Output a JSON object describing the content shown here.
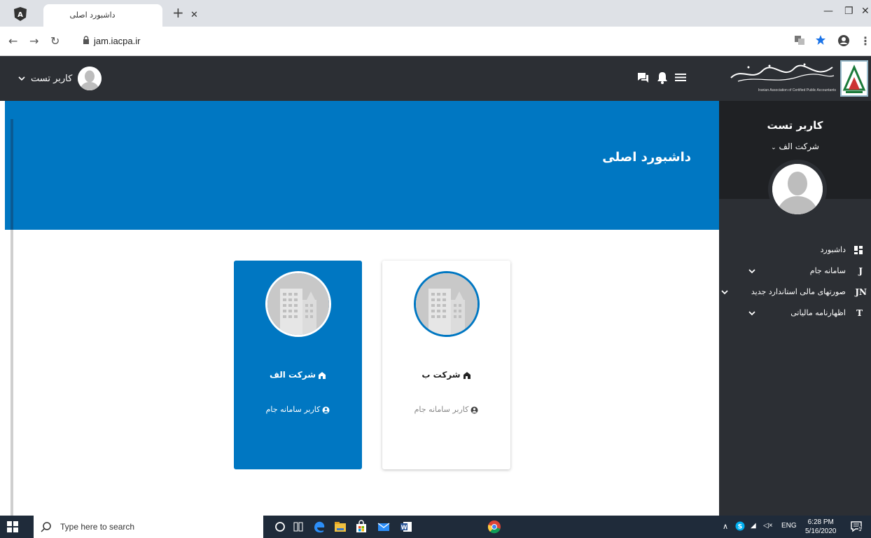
{
  "browser": {
    "tab_title": "داشبورد اصلی",
    "url": "jam.iacpa.ir"
  },
  "topbar": {
    "user_name": "کاربر تست"
  },
  "sidebar": {
    "logo_caption": "Iranian Association of Certified Public Accountants",
    "user_name": "کاربر تست",
    "company": "شرکت الف",
    "items": [
      {
        "label": "داشبورد",
        "icon": "dashboard-icon"
      },
      {
        "label": "سامانه جام",
        "icon": "J",
        "has_submenu": true
      },
      {
        "label": "صورتهای مالی استاندارد جدید",
        "icon": "JN",
        "has_submenu": true
      },
      {
        "label": "اظهارنامه مالیاتی",
        "icon": "T",
        "has_submenu": true
      }
    ]
  },
  "banner": {
    "title": "داشبورد اصلی"
  },
  "cards": [
    {
      "title": "شرکت الف",
      "role": "کاربر سامانه جام",
      "selected": true
    },
    {
      "title": "شرکت ب",
      "role": "کاربر سامانه جام",
      "selected": false
    }
  ],
  "taskbar": {
    "search_placeholder": "Type here to search",
    "language": "ENG",
    "time": "6:28 PM",
    "date": "5/16/2020",
    "notification_count": "1"
  },
  "colors": {
    "primary": "#0077c2",
    "dark": "#2c2f34",
    "sidebar_profile": "#1f2124"
  }
}
